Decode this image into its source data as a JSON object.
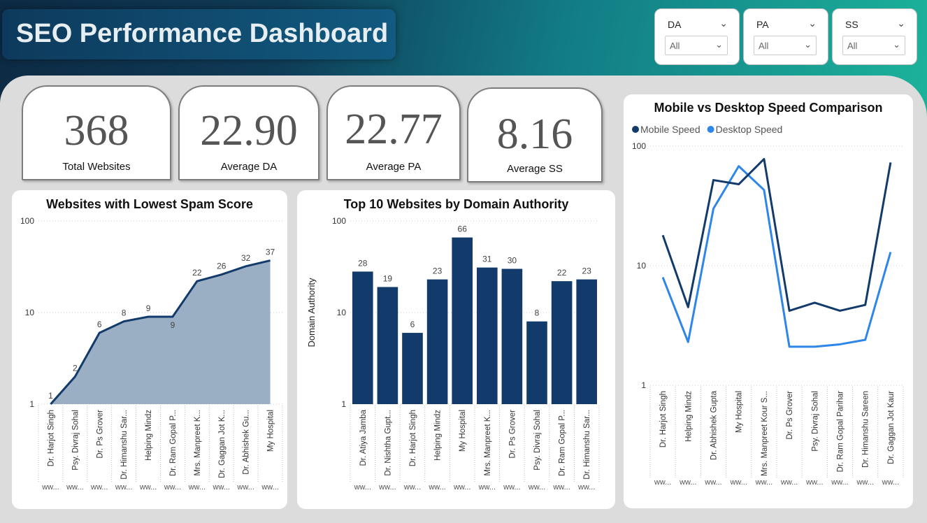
{
  "header": {
    "title": "SEO Performance Dashboard"
  },
  "filters": [
    {
      "label": "DA",
      "value": "All"
    },
    {
      "label": "PA",
      "value": "All"
    },
    {
      "label": "SS",
      "value": "All"
    }
  ],
  "kpis": [
    {
      "value": "368",
      "label": "Total Websites"
    },
    {
      "value": "22.90",
      "label": "Average DA"
    },
    {
      "value": "22.77",
      "label": "Average PA"
    },
    {
      "value": "8.16",
      "label": "Average SS"
    }
  ],
  "chart_data": [
    {
      "type": "area",
      "title": "Websites with Lowest Spam Score",
      "yscale": "log",
      "ylim": [
        1,
        100
      ],
      "yticks": [
        "1",
        "10",
        "100"
      ],
      "categories": [
        "Dr. Harjot Singh",
        "Psy. Divraj Sohal",
        "Dr. Ps Grover",
        "Dr. Himanshu Sar...",
        "Helping Mindz",
        "Dr. Ram Gopal P...",
        "Mrs. Manpreet K...",
        "Dr. Gaggan Jot K...",
        "Dr. Abhishek Gu...",
        "My Hospital"
      ],
      "subcategory_label": "ww...",
      "values": [
        1,
        2,
        6,
        8,
        9,
        9,
        22,
        26,
        32,
        37
      ],
      "color": "#123b6b",
      "fill": "#9aaec4"
    },
    {
      "type": "bar",
      "title": "Top 10 Websites by Domain Authority",
      "ylabel": "Domain Authority",
      "yscale": "log",
      "ylim": [
        1,
        100
      ],
      "yticks": [
        "1",
        "10",
        "100"
      ],
      "categories": [
        "Dr. Atiya Jamba",
        "Dr. Nishtha Gupt...",
        "Dr. Harjot Singh",
        "Helping Mindz",
        "My Hospital",
        "Mrs. Manpreet K...",
        "Dr. Ps Grover",
        "Psy. Divraj Sohal",
        "Dr. Ram Gopal P...",
        "Dr. Himanshu Sar..."
      ],
      "subcategory_label": "ww...",
      "values": [
        28,
        19,
        6,
        23,
        66,
        31,
        30,
        8,
        22,
        23
      ],
      "color": "#123b6b"
    },
    {
      "type": "line",
      "title": "Mobile vs Desktop Speed Comparison",
      "yscale": "log",
      "ylim": [
        1,
        100
      ],
      "yticks": [
        "1",
        "10",
        "100"
      ],
      "legend_position": "top-left",
      "categories": [
        "Dr. Harjot Singh",
        "Helping Mindz",
        "Dr. Abhishek Gupta",
        "My Hospital",
        "Mrs. Manpreet Kour S...",
        "Dr. Ps Grover",
        "Psy. Divraj Sohal",
        "Dr. Ram Gopal Parihar",
        "Dr. Himanshu Sareen",
        "Dr. Gaggan Jot Kaur"
      ],
      "subcategory_label": "ww...",
      "series": [
        {
          "name": "Mobile Speed",
          "color": "#123b6b",
          "values": [
            18,
            4.5,
            52,
            48,
            78,
            4.2,
            4.9,
            4.2,
            4.7,
            73
          ]
        },
        {
          "name": "Desktop Speed",
          "color": "#2e86e8",
          "values": [
            8,
            2.3,
            30,
            68,
            43,
            2.1,
            2.1,
            2.2,
            2.4,
            13
          ]
        }
      ]
    }
  ]
}
